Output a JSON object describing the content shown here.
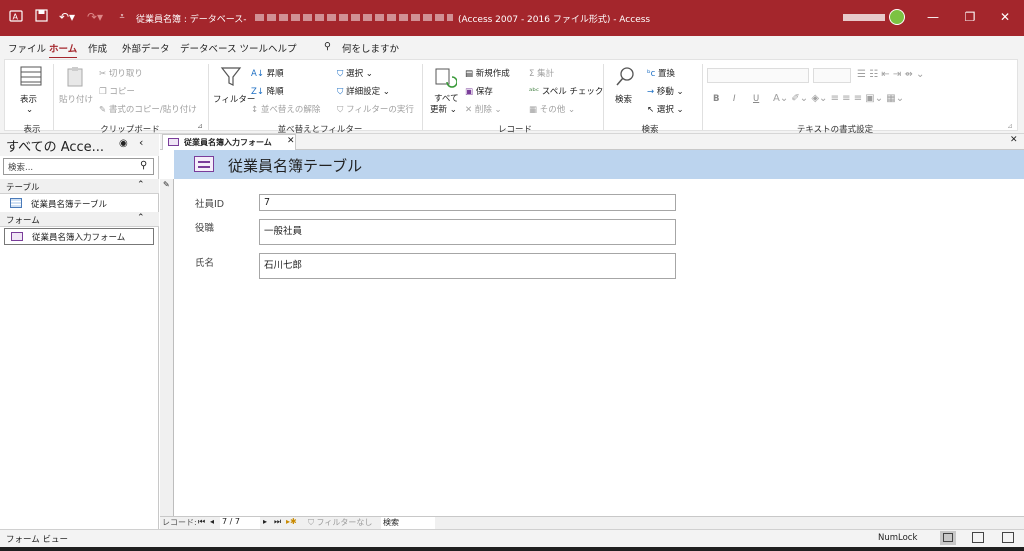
{
  "titlebar": {
    "title": "従業員名簿 : データベース- ",
    "title_suffix": "(Access 2007 - 2016 ファイル形式)  -  Access",
    "user": "",
    "minimize": "—",
    "restore": "❐",
    "close": "✕"
  },
  "menu": {
    "file": "ファイル",
    "home": "ホーム",
    "create": "作成",
    "external": "外部データ",
    "dbtools": "データベース ツール",
    "help": "ヘルプ",
    "tellme": "何をしますか"
  },
  "ribbon": {
    "view": {
      "label": "表示",
      "group": "表示"
    },
    "clipboard": {
      "paste": "貼り付け",
      "cut": "切り取り",
      "copy": "コピー",
      "format_painter": "書式のコピー/貼り付け",
      "group": "クリップボード"
    },
    "sort": {
      "filter": "フィルター",
      "asc": "昇順",
      "desc": "降順",
      "remove_sort": "並べ替えの解除",
      "select": "選択",
      "advanced": "詳細設定",
      "toggle_filter": "フィルターの実行",
      "group": "並べ替えとフィルター"
    },
    "records": {
      "refresh": "すべて",
      "refresh2": "更新",
      "new": "新規作成",
      "save": "保存",
      "delete": "削除",
      "totals": "集計",
      "spelling": "スペル チェック",
      "more": "その他",
      "group": "レコード"
    },
    "find": {
      "find": "検索",
      "replace": "置換",
      "goto": "移動",
      "select": "選択",
      "group": "検索"
    },
    "text": {
      "group": "テキストの書式設定",
      "bold": "B",
      "italic": "I",
      "underline": "U"
    }
  },
  "nav": {
    "title": "すべての Acce...",
    "search_placeholder": "検索...",
    "sections": [
      {
        "label": "テーブル",
        "items": [
          "従業員名簿テーブル"
        ]
      },
      {
        "label": "フォーム",
        "items": [
          "従業員名簿入力フォーム"
        ]
      }
    ]
  },
  "doc": {
    "tab_label": "従業員名簿入力フォーム",
    "form_title": "従業員名簿テーブル",
    "fields": [
      {
        "label": "社員ID",
        "value": "7"
      },
      {
        "label": "役職",
        "value": "一般社員"
      },
      {
        "label": "氏名",
        "value": "石川七郎"
      }
    ],
    "record_nav": {
      "label": "レコード:",
      "position": "7 / 7",
      "filter": "フィルターなし",
      "search": "検索"
    }
  },
  "status": {
    "view": "フォーム ビュー",
    "numlock": "NumLock"
  },
  "colors": {
    "accent": "#a4262c",
    "form_header": "#bcd4ee"
  }
}
